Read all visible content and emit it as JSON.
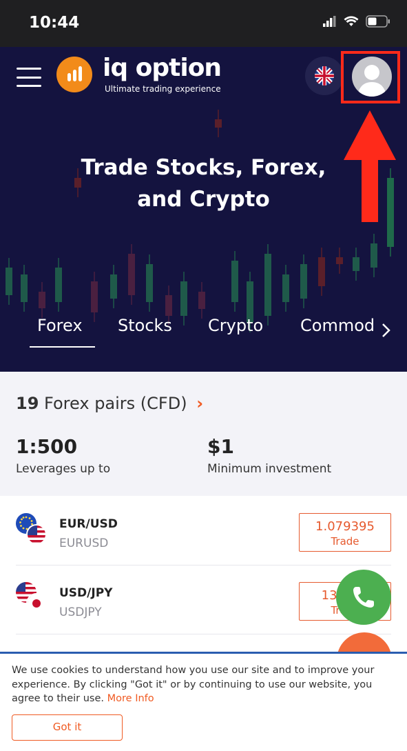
{
  "status_bar": {
    "time": "10:44"
  },
  "header": {
    "brand": "iq option",
    "tagline": "Ultimate trading experience",
    "language_icon": "uk-flag-icon",
    "account_icon": "user-avatar-icon"
  },
  "hero": {
    "title_line1": "Trade Stocks, Forex,",
    "title_line2": "and Crypto"
  },
  "tabs": [
    {
      "label": "Forex",
      "active": true
    },
    {
      "label": "Stocks",
      "active": false
    },
    {
      "label": "Crypto",
      "active": false
    },
    {
      "label": "Commod",
      "active": false
    }
  ],
  "summary": {
    "count": "19",
    "label": "Forex pairs (CFD)",
    "leverage_value": "1:500",
    "leverage_label": "Leverages up to",
    "min_value": "$1",
    "min_label": "Minimum investment"
  },
  "pairs": [
    {
      "name": "EUR/USD",
      "code": "EURUSD",
      "price": "1.079395",
      "action": "Trade"
    },
    {
      "name": "USD/JPY",
      "code": "USDJPY",
      "price": "133.3.7",
      "action": "Trade"
    }
  ],
  "cookie": {
    "text": "We use cookies to understand how you use our site and to improve your experience. By clicking \"Got it\" or by continuing to use our website, you agree to their use.",
    "link": "More Info",
    "button": "Got it"
  },
  "colors": {
    "hero_bg": "#14133f",
    "accent": "#f05a22",
    "call_fab": "#4caf50",
    "highlight": "#ff2a1a"
  }
}
